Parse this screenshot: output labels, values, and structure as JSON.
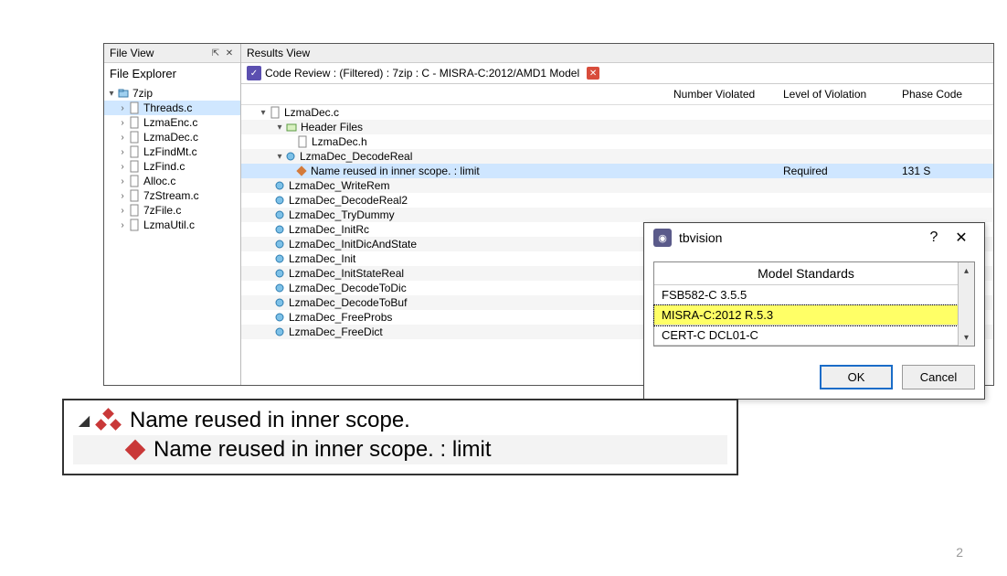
{
  "panels": {
    "file_view_title": "File View",
    "results_view_title": "Results View",
    "file_explorer_label": "File Explorer"
  },
  "file_tree": {
    "root": "7zip",
    "files": [
      "Threads.c",
      "LzmaEnc.c",
      "LzmaDec.c",
      "LzFindMt.c",
      "LzFind.c",
      "Alloc.c",
      "7zStream.c",
      "7zFile.c",
      "LzmaUtil.c"
    ]
  },
  "tab": {
    "label": "Code Review : (Filtered) : 7zip : C - MISRA-C:2012/AMD1 Model"
  },
  "columns": {
    "number_violated": "Number Violated",
    "level_violation": "Level of Violation",
    "phase_code": "Phase Code"
  },
  "results": {
    "file": "LzmaDec.c",
    "header_group": "Header Files",
    "header_file": "LzmaDec.h",
    "function": "LzmaDec_DecodeReal",
    "violation": "Name reused in inner scope. : limit",
    "level": "Required",
    "phase": "131 S",
    "functions": [
      "LzmaDec_WriteRem",
      "LzmaDec_DecodeReal2",
      "LzmaDec_TryDummy",
      "LzmaDec_InitRc",
      "LzmaDec_InitDicAndState",
      "LzmaDec_Init",
      "LzmaDec_InitStateReal",
      "LzmaDec_DecodeToDic",
      "LzmaDec_DecodeToBuf",
      "LzmaDec_FreeProbs",
      "LzmaDec_FreeDict"
    ]
  },
  "dialog": {
    "title": "tbvision",
    "header": "Model Standards",
    "items": [
      "FSB582-C 3.5.5",
      "MISRA-C:2012 R.5.3",
      "CERT-C DCL01-C"
    ],
    "ok": "OK",
    "cancel": "Cancel"
  },
  "callout": {
    "group": "Name reused in inner scope.",
    "item": "Name reused in inner scope. : limit"
  },
  "page_number": "2"
}
